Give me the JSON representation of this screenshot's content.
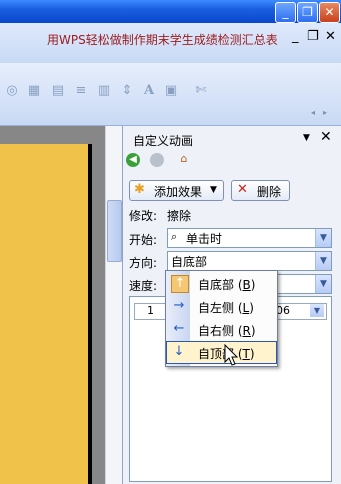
{
  "window": {
    "doc_title": "用WPS轻松做制作期末学生成绩检测汇总表"
  },
  "caption_buttons": {
    "minimize": "_",
    "restore": "❐",
    "close": "✕"
  },
  "mdi_buttons": {
    "minimize": "_",
    "restore": "❐",
    "close": "✕"
  },
  "toolbar": {
    "scroll_left": "◂",
    "scroll_right": "▸",
    "text_icon": "A"
  },
  "task_pane": {
    "title": "自定义动画",
    "dropdown_glyph": "▼",
    "close_glyph": "✕",
    "add_effect_label": "添加效果",
    "remove_label": "删除",
    "modify_label": "修改:",
    "modify_value": "擦除",
    "start_label": "开始:",
    "start_value": "单击时",
    "direction_label": "方向:",
    "direction_value": "自底部",
    "speed_label": "速度:",
    "list_item_number": "1",
    "list_item_suffix": "06"
  },
  "direction_menu": {
    "items": [
      {
        "label": "自底部",
        "accel": "B",
        "icon": "arrow-up-icon",
        "checked": true
      },
      {
        "label": "自左侧",
        "accel": "L",
        "icon": "arrow-right-icon",
        "checked": false
      },
      {
        "label": "自右侧",
        "accel": "R",
        "icon": "arrow-left-icon",
        "checked": false
      },
      {
        "label": "自顶部",
        "accel": "T",
        "icon": "arrow-down-icon",
        "hovered": true
      }
    ]
  },
  "colors": {
    "titlebar": "#0a46cc",
    "slide_fill": "#f1c24a",
    "doc_title_text": "#9b1c1c",
    "menu_hover": "#fff3cd"
  }
}
